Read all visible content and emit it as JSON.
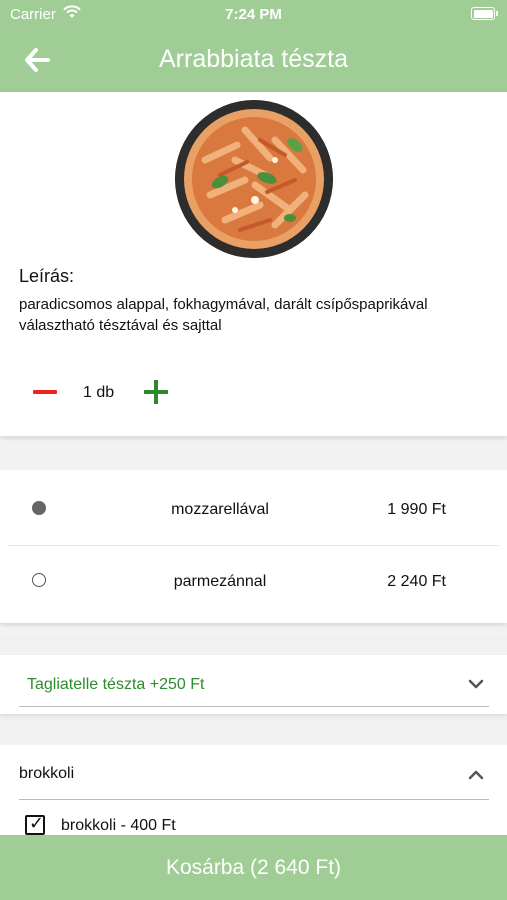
{
  "status_bar": {
    "carrier": "Carrier",
    "time": "7:24 PM"
  },
  "header": {
    "title": "Arrabbiata tészta"
  },
  "product": {
    "description_label": "Leírás:",
    "description": "paradicsomos alappal, fokhagymával, darált csípőspaprikával\nválasztható tésztával és sajttal",
    "quantity": "1 db"
  },
  "options": [
    {
      "label": "mozzarellával",
      "price": "1 990 Ft",
      "selected": true
    },
    {
      "label": "parmezánnal",
      "price": "2 240 Ft",
      "selected": false
    }
  ],
  "pasta_dropdown": {
    "selected": "Tagliatelle tészta +250 Ft"
  },
  "extras": {
    "group_label": "brokkoli",
    "items": [
      {
        "label": "brokkoli - 400 Ft",
        "checked": true
      }
    ]
  },
  "cart": {
    "label": "Kosárba (2 640 Ft)"
  },
  "colors": {
    "accent": "#9fcd95",
    "green_text": "#2e8b2e",
    "minus": "#e22222",
    "plus": "#2a8a2a"
  }
}
